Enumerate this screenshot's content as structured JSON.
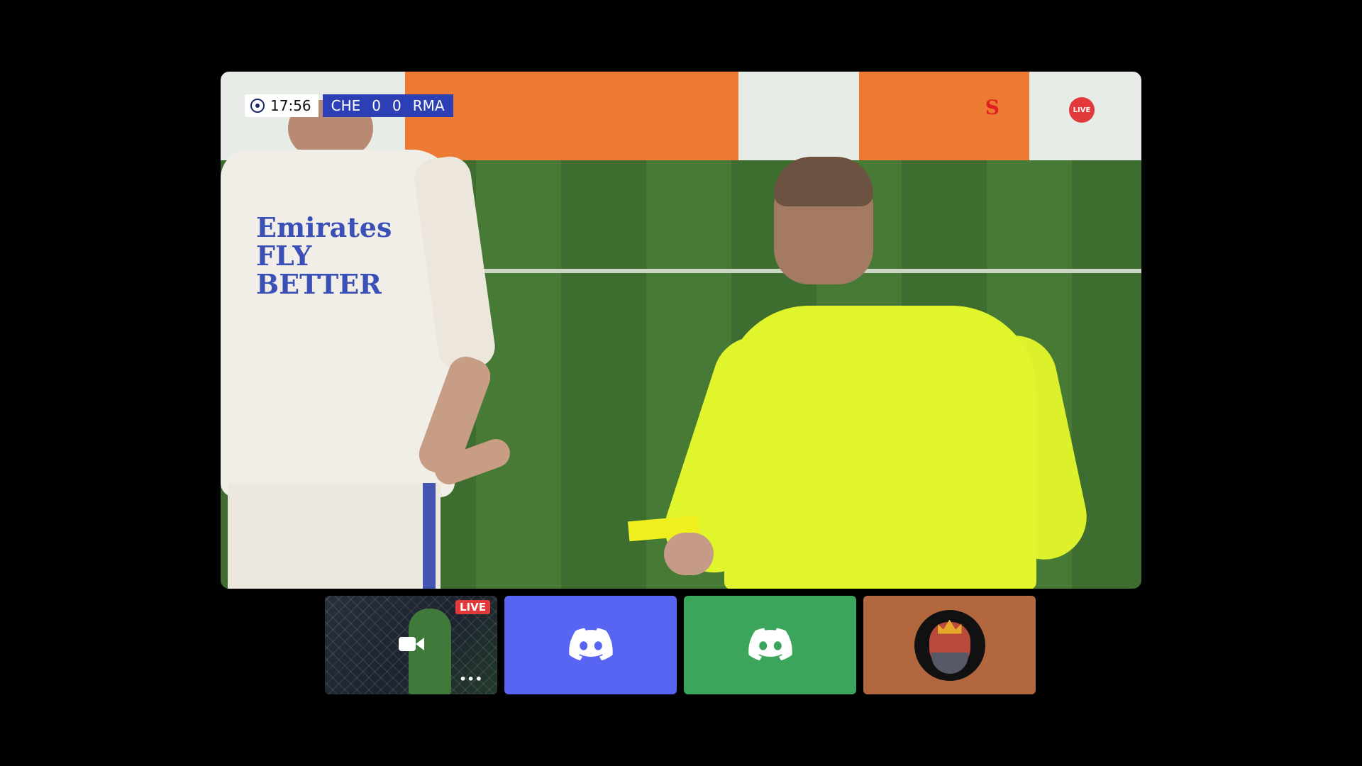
{
  "main_stream": {
    "scoreboard": {
      "clock": "17:56",
      "home_team": "CHE",
      "home_score": "0",
      "away_score": "0",
      "away_team": "RMA"
    },
    "live_badge": "LIVE",
    "sponsor_text": "Emirates FLY BETTER",
    "channel_logo": "S"
  },
  "tiles": [
    {
      "type": "video",
      "live_label": "LIVE",
      "more_label": "•••",
      "icon": "video-camera-icon"
    },
    {
      "type": "discord",
      "icon": "discord-icon",
      "color": "#5865f2"
    },
    {
      "type": "discord",
      "icon": "discord-icon",
      "color": "#3ba55c"
    },
    {
      "type": "avatar",
      "icon": "king-avatar",
      "color": "#b2673f"
    }
  ]
}
